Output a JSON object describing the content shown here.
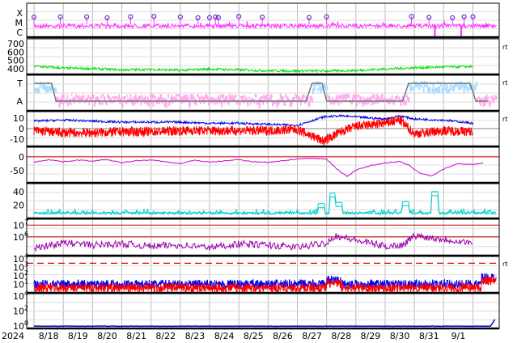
{
  "chart_data": {
    "type": "line",
    "x_tick_labels": [
      "2024",
      "8/18",
      "8/19",
      "8/20",
      "8/21",
      "8/22",
      "8/23",
      "8/24",
      "8/25",
      "8/26",
      "8/27",
      "8/28",
      "8/29",
      "8/30",
      "8/31",
      "9/1"
    ],
    "grid": true,
    "panels": [
      {
        "id": "flare-class",
        "type": "scatter",
        "y_tick_labels": [
          "X",
          "M",
          "C"
        ],
        "right_label": "",
        "series": [
          {
            "color": "#ff33ff",
            "baseline_level": "C",
            "spike_days": [
              30.7,
              31.6
            ]
          },
          {
            "color": "#6633cc",
            "marker": "circle",
            "event_days": [
              17.0,
              17.9,
              18.8,
              19.5,
              20.3,
              21.1,
              22.0,
              22.6,
              23.0,
              23.2,
              23.3,
              24.0,
              24.8,
              26.4,
              27.0,
              29.9,
              30.5,
              31.3,
              31.7,
              32.0
            ]
          }
        ]
      },
      {
        "id": "solar-wind-speed",
        "y_tick_labels": [
          "700",
          "600",
          "500",
          "400"
        ],
        "ylim": [
          330,
          760
        ],
        "right_label": "rt",
        "series": [
          {
            "color": "#00dd00",
            "x": [
              17,
              18,
              19,
              20,
              21,
              22,
              23,
              24,
              25,
              26,
              27,
              28,
              29,
              30,
              31,
              32
            ],
            "y": [
              430,
              405,
              400,
              385,
              390,
              380,
              395,
              385,
              375,
              372,
              372,
              378,
              395,
              410,
              420,
              425
            ]
          }
        ]
      },
      {
        "id": "imf-sector",
        "y_tick_labels": [
          "T",
          "A"
        ],
        "right_label": "rt",
        "series": [
          {
            "color": "#777777",
            "name": "",
            "x": [
              17,
              17.6,
              17.75,
              26.3,
              26.5,
              26.85,
              27.0,
              29.6,
              29.8,
              31.9,
              32.1,
              32.5
            ],
            "y": [
              "T",
              "T",
              "A",
              "A",
              "T",
              "T",
              "A",
              "A",
              "T",
              "T",
              "A",
              "A"
            ]
          },
          {
            "color": "#ffaaee"
          },
          {
            "color": "#aaddff"
          }
        ]
      },
      {
        "id": "imf-components",
        "y_tick_labels": [
          "10",
          "0",
          "-10"
        ],
        "ylim": [
          -17,
          16
        ],
        "right_label": "rt",
        "series": [
          {
            "color": "#0000dd",
            "x": [
              17,
              18,
              19,
              20,
              21,
              22,
              23,
              24,
              25,
              26,
              26.9,
              27.5,
              28,
              29,
              29.5,
              30,
              31,
              32
            ],
            "y": [
              7,
              8,
              7,
              6,
              6,
              6,
              5,
              5,
              4,
              3,
              11,
              12,
              11,
              9,
              12,
              9,
              8,
              5
            ]
          },
          {
            "color": "#ff0000",
            "x": [
              17,
              18,
              19,
              20,
              21,
              22,
              23,
              24,
              25,
              26,
              26.9,
              27.5,
              28,
              29,
              29.5,
              30,
              31,
              32
            ],
            "y": [
              -2,
              -4,
              -4,
              -3,
              -3,
              -2,
              -2,
              -2,
              -2,
              -1,
              -12,
              -3,
              2,
              5,
              8,
              -5,
              -2,
              -3
            ]
          }
        ]
      },
      {
        "id": "dst-index",
        "y_tick_labels": [
          "0",
          "-50"
        ],
        "ylim": [
          -95,
          35
        ],
        "right_label": "",
        "series": [
          {
            "color": "#cc00cc",
            "x": [
              17,
              17.5,
              18,
              18.5,
              19,
              19.5,
              20,
              20.5,
              21,
              21.5,
              22,
              22.5,
              23,
              23.5,
              24,
              24.5,
              25,
              25.5,
              26,
              26.5,
              27,
              27.3,
              27.7,
              28,
              28.5,
              29,
              29.5,
              29.8,
              30.2,
              30.6,
              31,
              31.5,
              32,
              32.4
            ],
            "y": [
              -20,
              -10,
              -18,
              -12,
              -15,
              -10,
              -22,
              -14,
              -12,
              -18,
              -25,
              -12,
              -20,
              -15,
              -10,
              -18,
              -20,
              -14,
              -8,
              -6,
              -8,
              -40,
              -72,
              -48,
              -32,
              -22,
              -18,
              -30,
              -60,
              -70,
              -45,
              -25,
              -28,
              -22
            ]
          }
        ]
      },
      {
        "id": "speed-aux",
        "y_tick_labels": [
          "40",
          "20"
        ],
        "ylim": [
          0,
          52
        ],
        "right_label": "",
        "series": [
          {
            "color": "#00cccc",
            "spike_days": [
              26.8,
              27.2,
              27.4,
              29.7,
              30.7
            ],
            "spike_values": [
              22,
              38,
              24,
              25,
              40
            ],
            "baseline": 8
          }
        ]
      },
      {
        "id": "electron-flux",
        "y_tick_labels": [
          "10^7",
          "10^6"
        ],
        "right_label": "",
        "reference_lines": [
          "10^7",
          "10^6"
        ],
        "series": [
          {
            "color": "#9900aa",
            "x": [
              17,
              18,
              19,
              20,
              21,
              22,
              23,
              24,
              25,
              26,
              26.5,
              27,
              27.3,
              28,
              29,
              29.6,
              30,
              31,
              32
            ],
            "y": [
              5.0,
              5.5,
              5.3,
              5.4,
              5.2,
              5.3,
              5.1,
              5.4,
              5.3,
              5.1,
              5.3,
              5.5,
              6.1,
              5.7,
              5.2,
              5.3,
              6.1,
              5.8,
              5.5
            ]
          }
        ]
      },
      {
        "id": "proton-flux",
        "y_tick_labels": [
          "10^4",
          "10^3",
          "10^2",
          "10^1",
          "10^0"
        ],
        "right_label": "rt",
        "reference_lines": [
          "10^3.5"
        ],
        "series": [
          {
            "color": "#0000ee",
            "level": 1.0
          },
          {
            "color": "#ff0000",
            "level": 0.6
          }
        ]
      },
      {
        "id": "high-energy-flux",
        "y_tick_labels": [
          "10^4",
          "10^2",
          "10^0"
        ],
        "right_label": "",
        "series": [
          {
            "color": "#0000cc",
            "level": 0,
            "rise_end": 1.2
          }
        ]
      }
    ]
  }
}
